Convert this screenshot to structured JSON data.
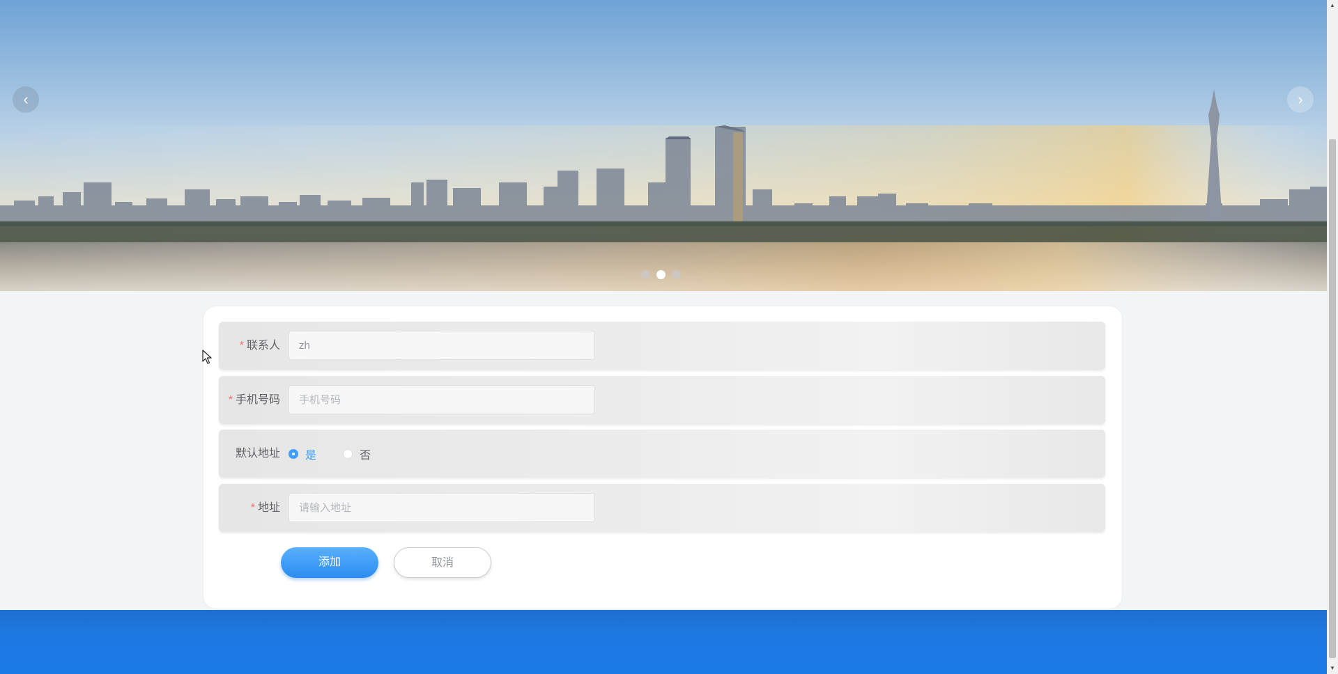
{
  "banner": {
    "prev_icon": "chevron-left-icon",
    "next_icon": "chevron-right-icon",
    "prev_glyph": "‹",
    "next_glyph": "›",
    "slide_count": 3,
    "active_slide": 2
  },
  "form": {
    "contact": {
      "label": "联系人",
      "required": true,
      "value": "zh",
      "placeholder": ""
    },
    "phone": {
      "label": "手机号码",
      "required": true,
      "value": "",
      "placeholder": "手机号码"
    },
    "default_address": {
      "label": "默认地址",
      "options": [
        {
          "label": "是",
          "checked": true
        },
        {
          "label": "否",
          "checked": false
        }
      ]
    },
    "address": {
      "label": "地址",
      "required": true,
      "value": "",
      "placeholder": "请输入地址"
    },
    "required_mark": "*",
    "submit_label": "添加",
    "cancel_label": "取消"
  },
  "colors": {
    "primary": "#409eff",
    "required": "#f56c6c",
    "footer": "#1e78e3"
  }
}
